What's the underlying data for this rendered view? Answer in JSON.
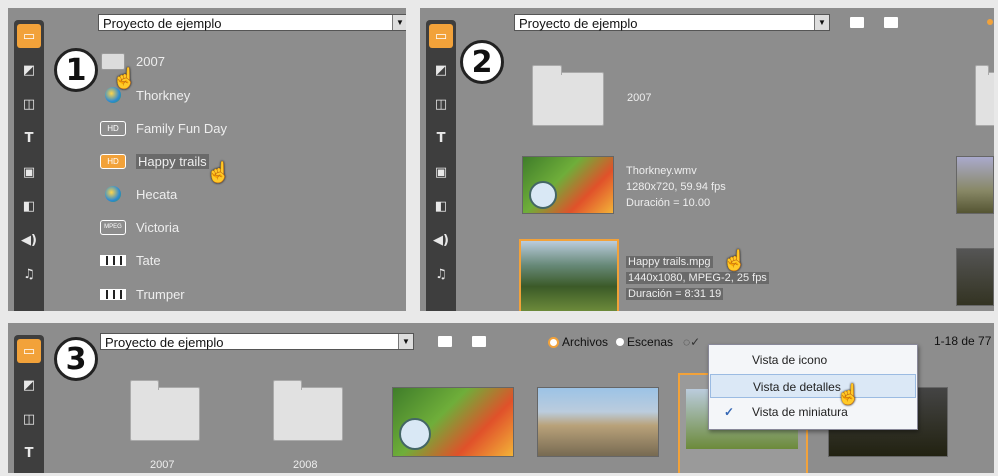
{
  "panels": {
    "one": {
      "step": "1",
      "combo": "Proyecto de ejemplo",
      "items": [
        {
          "label": "2007"
        },
        {
          "label": "Thorkney"
        },
        {
          "label": "Family Fun Day"
        },
        {
          "label": "Happy trails"
        },
        {
          "label": "Hecata"
        },
        {
          "label": "Victoria"
        },
        {
          "label": "Tate"
        },
        {
          "label": "Trumper"
        }
      ],
      "badges": {
        "hd": "HD",
        "mpeg": "MPEG"
      }
    },
    "two": {
      "step": "2",
      "combo": "Proyecto de ejemplo",
      "folder_label": "2007",
      "file1": {
        "name": "Thorkney.wmv",
        "res": "1280x720, 59.94 fps",
        "dur": "Duración = 10.00"
      },
      "file2": {
        "name": "Happy trails.mpg",
        "res": "1440x1080, MPEG-2, 25 fps",
        "dur": "Duración = 8:31 19"
      }
    },
    "three": {
      "step": "3",
      "combo": "Proyecto de ejemplo",
      "radio_files": "Archivos",
      "radio_scenes": "Escenas",
      "count": "1-18 de 77",
      "folders": [
        "2007",
        "2008"
      ],
      "menu": [
        {
          "label": "Vista de icono",
          "checked": false
        },
        {
          "label": "Vista de detalles",
          "checked": false
        },
        {
          "label": "Vista de miniatura",
          "checked": true
        }
      ]
    }
  },
  "sidebar_icons": [
    "library-tab-icon",
    "transitions-tab-icon",
    "montage-tab-icon",
    "titles-tab-icon",
    "photo-tab-icon",
    "menus-tab-icon",
    "sound-tab-icon",
    "music-tab-icon"
  ],
  "colors": {
    "panel": "#8d8d8d",
    "sidebar": "#3e3e3e",
    "accent": "#f2a23a"
  }
}
